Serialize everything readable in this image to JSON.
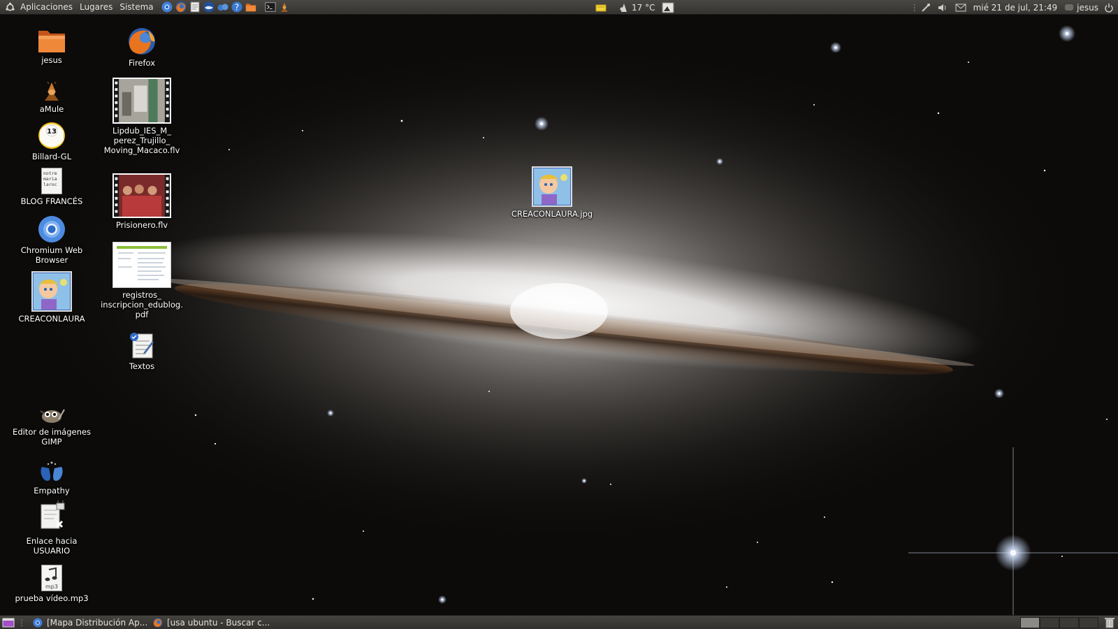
{
  "top_panel": {
    "menus": {
      "applications": "Aplicaciones",
      "places": "Lugares",
      "system": "Sistema"
    },
    "launchers": [
      "chromium-icon",
      "firefox-icon",
      "text-editor-icon",
      "thunderbird-icon",
      "pidgin-icon",
      "help-icon",
      "folder-icon",
      "terminal-icon",
      "amule-icon"
    ],
    "weather": "17 °C",
    "clock": "mié 21 de jul, 21:49",
    "user": "jesus"
  },
  "desktop": {
    "icons": [
      {
        "label": "jesus",
        "icon": "home-folder-icon"
      },
      {
        "label": "aMule",
        "icon": "amule-icon"
      },
      {
        "label": "Billard-GL",
        "icon": "billiard-ball-icon"
      },
      {
        "label": "BLOG FRANCÉS",
        "icon": "text-document-icon",
        "thumb_lines": [
          "notre",
          "maria",
          "laroc"
        ]
      },
      {
        "label": "Chromium Web Browser",
        "icon": "chromium-icon"
      },
      {
        "label": "CREACONLAURA",
        "icon": "cartoon-image-icon"
      },
      {
        "label": "Editor de imágenes GIMP",
        "icon": "gimp-icon"
      },
      {
        "label": "Empathy",
        "icon": "empathy-icon"
      },
      {
        "label": "Enlace hacia USUARIO",
        "icon": "broken-link-icon"
      },
      {
        "label": "prueba vídeo.mp3",
        "icon": "mp3-file-icon",
        "badge": "mp3"
      },
      {
        "label": "Firefox",
        "icon": "firefox-icon"
      },
      {
        "label": "Lipdub_IES_M_ perez_Trujillo_ Moving_Macaco.flv",
        "icon": "video-thumbnail-icon"
      },
      {
        "label": "Prisionero.flv",
        "icon": "video-thumbnail-icon"
      },
      {
        "label": "registros_ inscripcion_edublog. pdf",
        "icon": "pdf-thumbnail-icon"
      },
      {
        "label": "Textos",
        "icon": "text-editor-icon"
      },
      {
        "label": "CREACONLAURA.jpg",
        "icon": "cartoon-image-icon"
      }
    ]
  },
  "bottom_panel": {
    "tasks": [
      {
        "label": "[Mapa Distribución Ap...",
        "icon": "chromium-icon"
      },
      {
        "label": "[usa ubuntu - Buscar c...",
        "icon": "firefox-icon"
      }
    ],
    "workspaces": 4,
    "active_workspace": 1
  },
  "colors": {
    "panel": "#3c3b37",
    "accent": "#e05a1e"
  }
}
